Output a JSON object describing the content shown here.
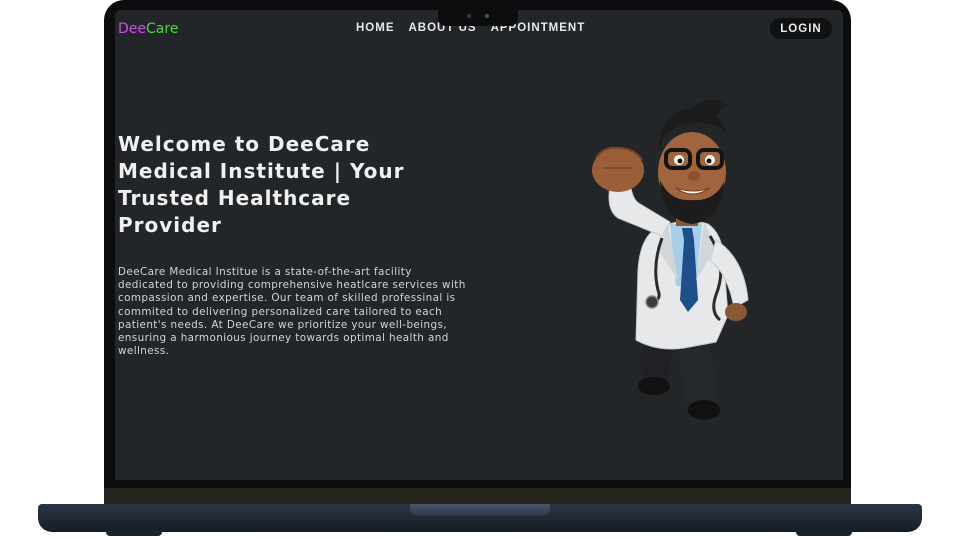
{
  "brand": {
    "part1": "Dee",
    "part2": "Care",
    "color1": "#d24be8",
    "color2": "#52d24a"
  },
  "nav": {
    "home": "HOME",
    "about": "ABOUT US",
    "appointment": "APPOINTMENT"
  },
  "login": "LOGIN",
  "hero": {
    "title": "Welcome to DeeCare Medical Institute | Your Trusted Healthcare Provider",
    "text": "DeeCare Medical Institue is a state-of-the-art facility dedicated to providing comprehensive heatlcare services with compassion and expertise. Our team of skilled professinal is commited to delivering personalized care tailored to each patient's needs. At DeeCare we prioritize your well-beings, ensuring a harmonious journey towards optimal health and wellness."
  },
  "illustration": {
    "icon": "doctor-superhero-illustration"
  },
  "colors": {
    "background": "#232629",
    "text": "#f0f0f0",
    "frame": "#0d0d0f"
  }
}
